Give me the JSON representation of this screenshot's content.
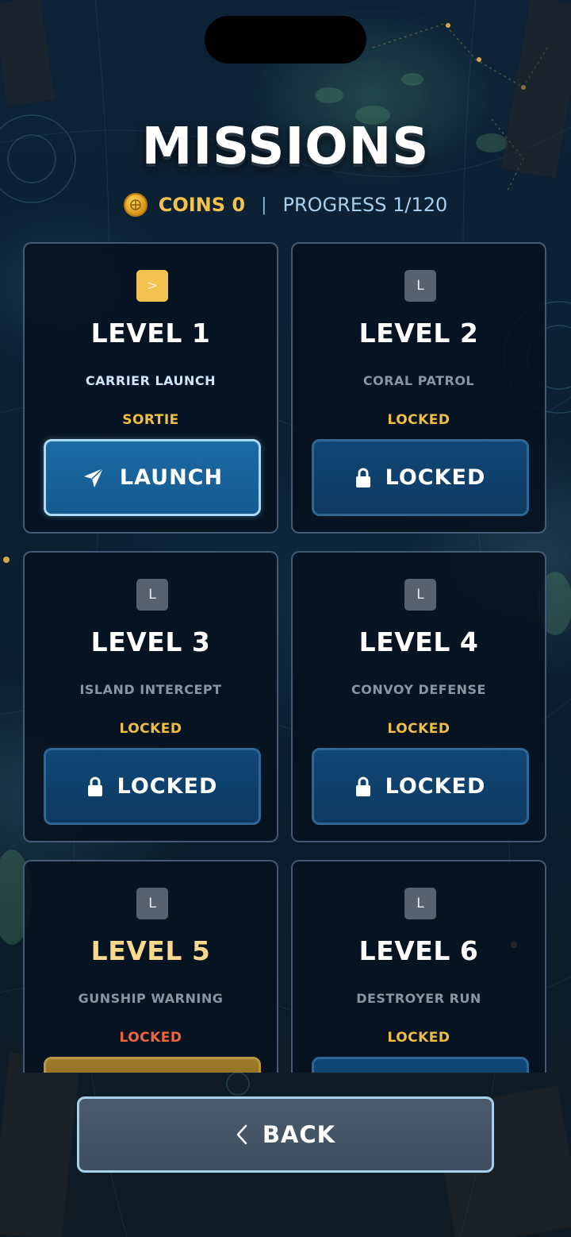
{
  "header": {
    "title": "MISSIONS",
    "coins_label": "COINS 0",
    "separator": "|",
    "progress_label": "PROGRESS 1/120"
  },
  "levels": [
    {
      "badge": ">",
      "title": "LEVEL 1",
      "subtitle": "CARRIER LAUNCH",
      "status": "SORTIE",
      "button": "LAUNCH",
      "button_icon": "paper-plane-icon",
      "state": "active"
    },
    {
      "badge": "L",
      "title": "LEVEL 2",
      "subtitle": "CORAL PATROL",
      "status": "LOCKED",
      "button": "LOCKED",
      "button_icon": "lock-icon",
      "state": "locked"
    },
    {
      "badge": "L",
      "title": "LEVEL 3",
      "subtitle": "ISLAND INTERCEPT",
      "status": "LOCKED",
      "button": "LOCKED",
      "button_icon": "lock-icon",
      "state": "locked"
    },
    {
      "badge": "L",
      "title": "LEVEL 4",
      "subtitle": "CONVOY DEFENSE",
      "status": "LOCKED",
      "button": "LOCKED",
      "button_icon": "lock-icon",
      "state": "locked"
    },
    {
      "badge": "L",
      "title": "LEVEL 5",
      "subtitle": "GUNSHIP WARNING",
      "status": "LOCKED",
      "button": "",
      "button_icon": "",
      "state": "locked-special"
    },
    {
      "badge": "L",
      "title": "LEVEL 6",
      "subtitle": "DESTROYER RUN",
      "status": "LOCKED",
      "button": "",
      "button_icon": "",
      "state": "locked"
    }
  ],
  "footer": {
    "back_label": "BACK",
    "back_icon": "chevron-left-icon"
  },
  "colors": {
    "gold": "#f1c24f",
    "locked_status": "#f1bd42",
    "warning_status": "#f0653e",
    "button_blue": "#104776",
    "launch_border": "#a9d9f6"
  }
}
